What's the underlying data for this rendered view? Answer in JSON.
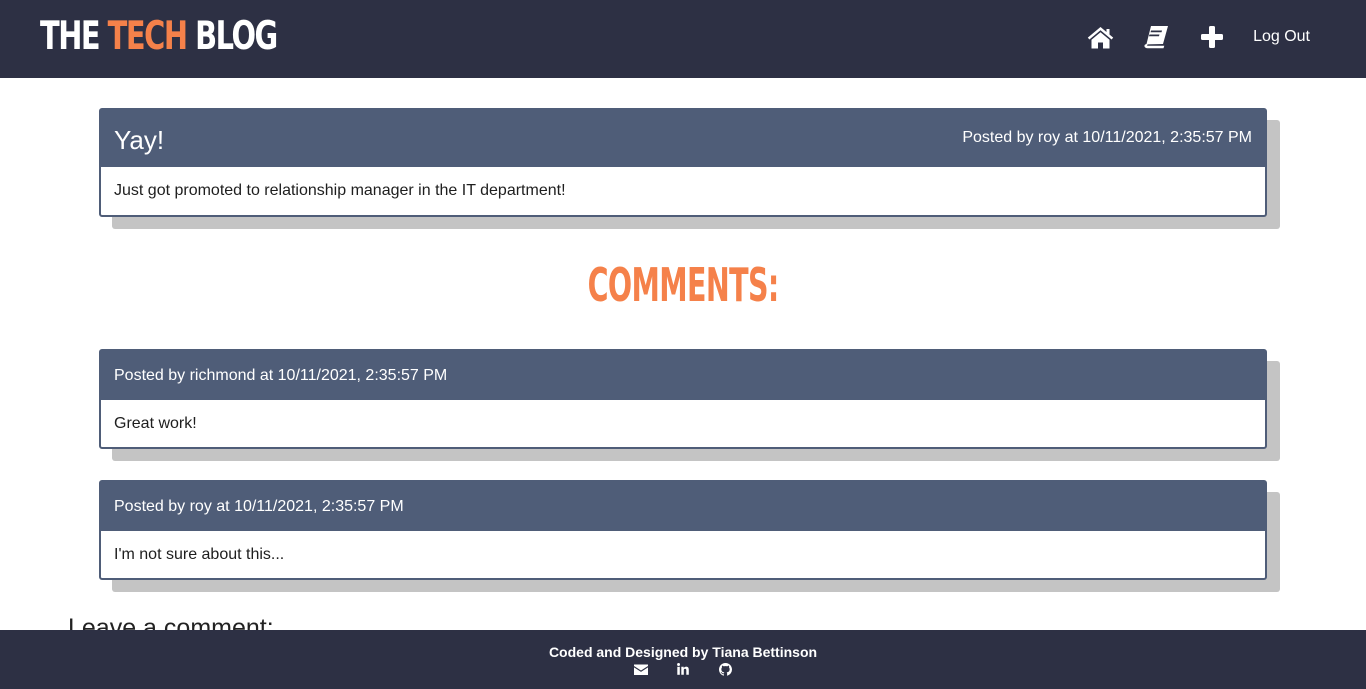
{
  "header": {
    "brand_part1": "THE ",
    "brand_accent": "TECH",
    "brand_part2": " BLOG",
    "nav": {
      "home_icon": "home-icon",
      "dashboard_icon": "book-icon",
      "new_post_icon": "plus-icon",
      "logout_label": "Log Out"
    }
  },
  "post": {
    "title": "Yay!",
    "meta": "Posted by roy at 10/11/2021, 2:35:57 PM",
    "body": "Just got promoted to relationship manager in the IT department!"
  },
  "comments_heading": "COMMENTS:",
  "comments": [
    {
      "meta": "Posted by richmond at 10/11/2021, 2:35:57 PM",
      "body": "Great work!"
    },
    {
      "meta": "Posted by roy at 10/11/2021, 2:35:57 PM",
      "body": "I'm not sure about this..."
    }
  ],
  "comment_form": {
    "heading": "Leave a comment:"
  },
  "footer": {
    "credit": "Coded and Designed by Tiana Bettinson",
    "icons": [
      "envelope-icon",
      "linkedin-icon",
      "github-icon"
    ]
  },
  "colors": {
    "navbar": "#2d3044",
    "accent": "#f5814a",
    "card_header": "#4f5d78",
    "card_shadow": "#c4c4c4"
  }
}
